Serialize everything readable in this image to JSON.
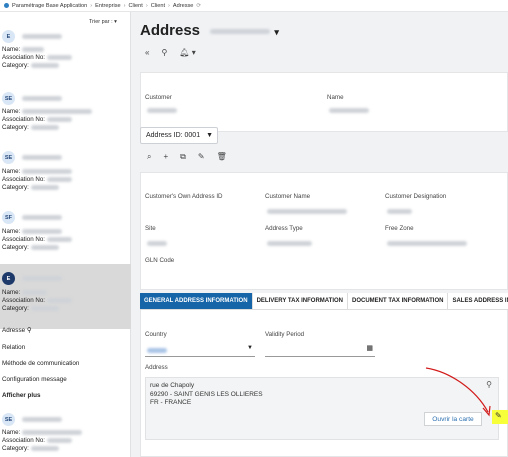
{
  "breadcrumb": [
    "Paramétrage Base Application",
    "Entreprise",
    "Client",
    "Client",
    "Adresse"
  ],
  "sidebar": {
    "sort_label": "Trier par :",
    "records": [
      {
        "initials": "E",
        "name_label": "Name:",
        "assoc_label": "Association No:",
        "cat_label": "Category:"
      },
      {
        "initials": "SE",
        "name_label": "Name:",
        "assoc_label": "Association No:",
        "cat_label": "Category:"
      },
      {
        "initials": "SE",
        "name_label": "Name:",
        "assoc_label": "Association No:",
        "cat_label": "Category:"
      },
      {
        "initials": "SF",
        "name_label": "Name:",
        "assoc_label": "Association No:",
        "cat_label": "Category:"
      },
      {
        "initials": "E",
        "name_label": "Name:",
        "assoc_label": "Association No:",
        "cat_label": "Category:"
      },
      {
        "initials": "SE",
        "name_label": "Name:",
        "assoc_label": "Association No:",
        "cat_label": "Category:"
      }
    ],
    "menu": [
      "Adresse",
      "Relation",
      "Méthode de communication",
      "Configuration message",
      "Afficher plus"
    ]
  },
  "main": {
    "title": "Address",
    "customer_label": "Customer",
    "name_label": "Name",
    "address_id_label": "Address ID: 0001",
    "fields": {
      "own_id": "Customer's Own Address ID",
      "cust_name": "Customer Name",
      "cust_desig": "Customer Designation",
      "site": "Site",
      "addr_type": "Address Type",
      "free_zone": "Free Zone",
      "gln": "GLN Code"
    },
    "tabs": [
      "GENERAL ADDRESS INFORMATION",
      "DELIVERY TAX INFORMATION",
      "DOCUMENT TAX INFORMATION",
      "SALES ADDRESS INFO"
    ],
    "country_label": "Country",
    "validity_label": "Validity Period",
    "address_label": "Address",
    "address_lines": [
      "rue de Chapoly",
      "69290 - SAINT GENIS LES OLLIERES",
      "FR - FRANCE"
    ],
    "map_button": "Ouvrir la carte"
  }
}
